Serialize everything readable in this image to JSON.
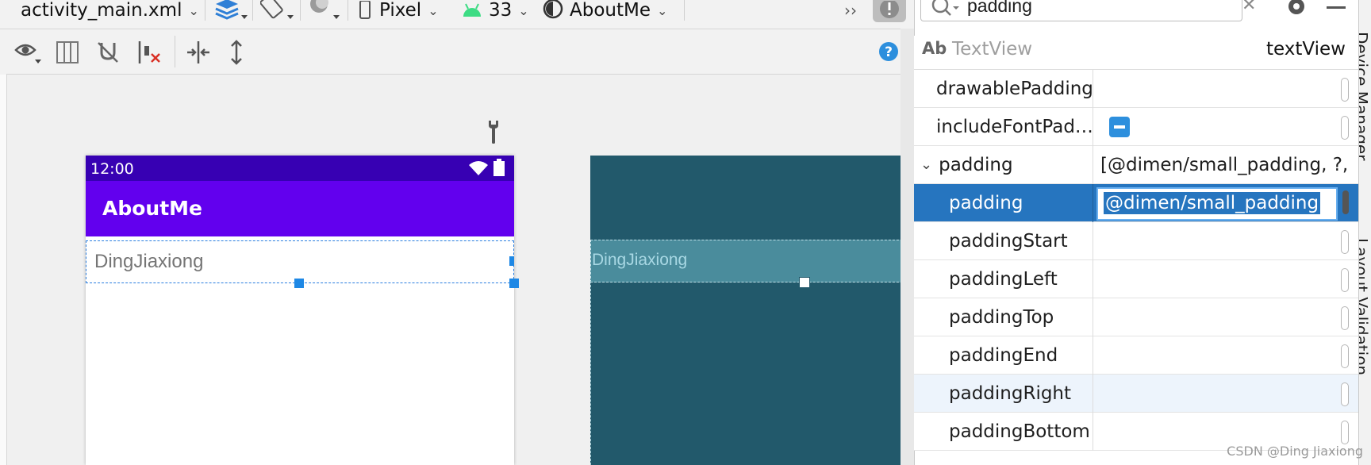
{
  "toolbar": {
    "file": "activity_main.xml",
    "device": "Pixel",
    "api_level": "33",
    "theme": "AboutMe",
    "overflow": "››"
  },
  "search": {
    "value": "padding"
  },
  "panel": {
    "widget_abbrev": "Ab",
    "widget_type": "TextView",
    "widget_id": "textView"
  },
  "attributes": [
    {
      "name": "drawablePadding",
      "value": ""
    },
    {
      "name": "includeFontPad…",
      "value": ""
    },
    {
      "name": "padding",
      "value": "[@dimen/small_padding, ?, ?"
    },
    {
      "name": "padding",
      "value": "@dimen/small_padding"
    },
    {
      "name": "paddingStart",
      "value": ""
    },
    {
      "name": "paddingLeft",
      "value": ""
    },
    {
      "name": "paddingTop",
      "value": ""
    },
    {
      "name": "paddingEnd",
      "value": ""
    },
    {
      "name": "paddingRight",
      "value": ""
    },
    {
      "name": "paddingBottom",
      "value": ""
    }
  ],
  "design": {
    "time": "12:00",
    "app_title": "AboutMe",
    "textview_text": "DingJiaxiong"
  },
  "blueprint": {
    "textview_text": "DingJiaxiong"
  },
  "side_tabs": {
    "device_manager": "Device Manager",
    "layout_validation": "Layout Validation"
  },
  "watermark": "CSDN @Ding Jiaxiong",
  "colors": {
    "status_bar": "#3700b3",
    "app_bar": "#6200ee",
    "blueprint_bg": "#22596b",
    "selection": "#2675bf",
    "handle": "#1e88e5"
  }
}
